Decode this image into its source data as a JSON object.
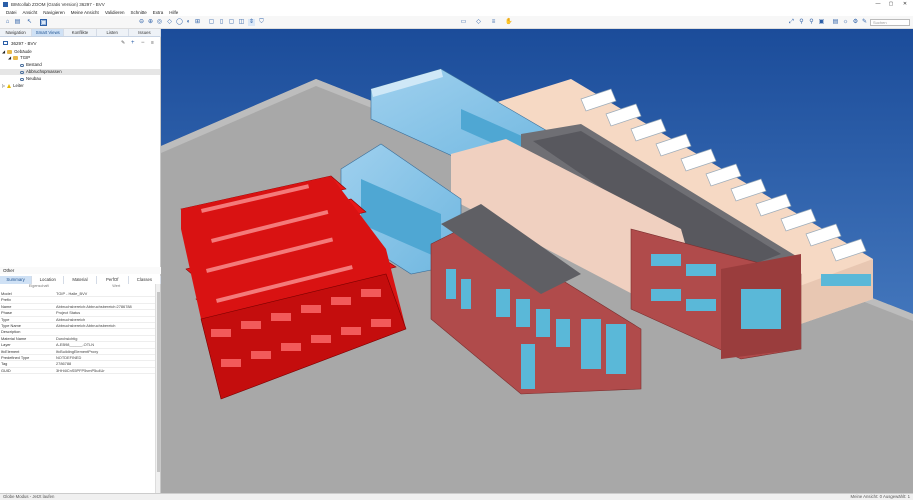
{
  "window": {
    "title": "BIMcollab ZOOM (Gratis Version) 36297 - BVV",
    "controls": [
      "—",
      "▢",
      "✕"
    ]
  },
  "menu": [
    "Datei",
    "Ansicht",
    "Navigieren",
    "Meine Ansicht",
    "Validieren",
    "Schnitte",
    "Extra",
    "Hilfe"
  ],
  "toolbar": {
    "search_placeholder": "Suchen"
  },
  "left_tabs": [
    {
      "label": "Navigation",
      "active": false
    },
    {
      "label": "Smart Views",
      "active": true
    },
    {
      "label": "Konflikte",
      "active": false
    },
    {
      "label": "Listen",
      "active": false
    },
    {
      "label": "Issues",
      "active": false
    }
  ],
  "model_label": "36297 - BVV",
  "tree": [
    {
      "label": "Gebäude",
      "icon": "folder"
    },
    {
      "label": "TGIP",
      "icon": "folder"
    },
    {
      "label": "Bestand",
      "icon": "eye"
    },
    {
      "label": "Abbruchspmassen",
      "icon": "eye",
      "selected": true
    },
    {
      "label": "Neubau",
      "icon": "eye"
    },
    {
      "label": "Leiter",
      "icon": "warn"
    }
  ],
  "props": {
    "header": "Other",
    "tabs": [
      {
        "label": "Summary",
        "active": true
      },
      {
        "label": "Location",
        "active": false
      },
      {
        "label": "Material",
        "active": false
      },
      {
        "label": "PerfOf",
        "active": false
      },
      {
        "label": "Classes",
        "active": false
      }
    ],
    "col_property": "Eigenschaft",
    "col_value": "Wert",
    "rows": [
      {
        "k": "Model",
        "v": "TGIP - Halle_BVV"
      },
      {
        "k": "Prefix",
        "v": ""
      },
      {
        "k": "Name",
        "v": "Abbruchsbereich:Abbruchsbereich:2786788"
      },
      {
        "k": "Phase",
        "v": "Project Status"
      },
      {
        "k": "Type",
        "v": "Abbruchsbereich"
      },
      {
        "k": "Type Name",
        "v": "Abbruchsbereich:Abbruchsbereich"
      },
      {
        "k": "Description",
        "v": ""
      },
      {
        "k": "Material Name",
        "v": "Durchsichtig"
      },
      {
        "k": "Layer",
        "v": "A-EB98______-OTLN"
      },
      {
        "k": "IfcElement",
        "v": "IfcBuildingElementProxy"
      },
      {
        "k": "Predefined Type",
        "v": "NOTDEFINED"
      },
      {
        "k": "Tag",
        "v": "2786788"
      },
      {
        "k": "GUID",
        "v": "3HH4iCnS5PFP5vmP5u4Ur"
      }
    ]
  },
  "status": {
    "left": "Globe Modus - Jetzt laufen",
    "right": "Meine Ansicht: 0 Ausgewählt: 1"
  },
  "colors": {
    "accent": "#2b5fa8",
    "sky_top": "#1b4c9a",
    "sky_bottom": "#5a8fd0",
    "ground": "#a8a8a8",
    "demolition_red": "#e81818",
    "brick": "#b04b4b",
    "glass": "#5ab8d8"
  }
}
